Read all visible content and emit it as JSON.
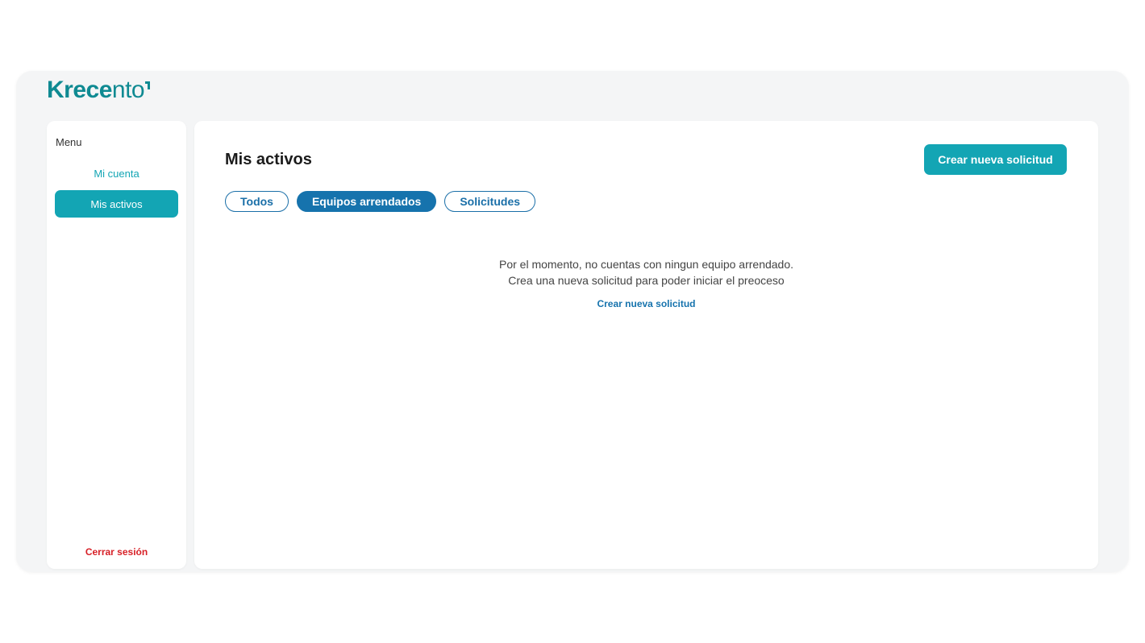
{
  "brand": {
    "logo_bold": "Krece",
    "logo_light": "nto",
    "color": "#0f8a92"
  },
  "sidebar": {
    "title": "Menu",
    "items": [
      {
        "label": "Mi cuenta",
        "active": false
      },
      {
        "label": "Mis activos",
        "active": true
      }
    ],
    "logout_label": "Cerrar sesión"
  },
  "main": {
    "title": "Mis activos",
    "primary_button_label": "Crear nueva solicitud",
    "tabs": [
      {
        "label": "Todos",
        "selected": false
      },
      {
        "label": "Equipos arrendados",
        "selected": true
      },
      {
        "label": "Solicitudes",
        "selected": false
      }
    ],
    "empty_state": {
      "line1": "Por el momento, no cuentas con ningun equipo arrendado.",
      "line2": "Crea una nueva solicitud para poder iniciar el preoceso",
      "link_label": "Crear nueva solicitud"
    }
  },
  "colors": {
    "accent": "#13a5b4",
    "tab_blue": "#1673ad",
    "danger": "#d72027"
  }
}
